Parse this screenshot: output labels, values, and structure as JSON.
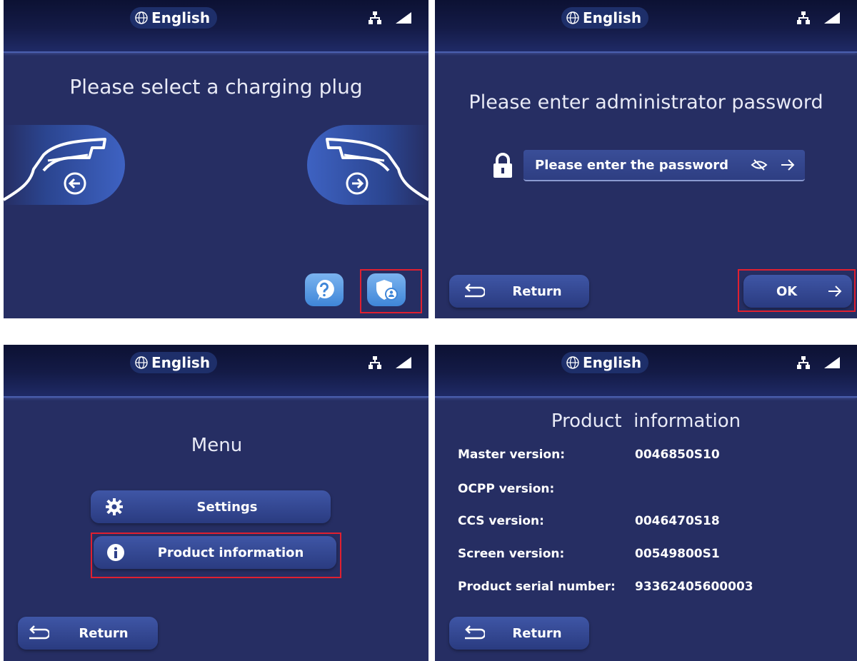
{
  "language_label": "English",
  "screen1": {
    "title": "Please select a charging plug"
  },
  "screen2": {
    "title": "Please enter administrator password",
    "password_placeholder": "Please enter the password",
    "return_label": "Return",
    "ok_label": "OK"
  },
  "screen3": {
    "title": "Menu",
    "items": [
      {
        "label": "Settings",
        "icon": "gear-icon"
      },
      {
        "label": "Product information",
        "icon": "info-icon"
      }
    ],
    "return_label": "Return"
  },
  "screen4": {
    "title": "Product  information",
    "rows": [
      {
        "label": "Master version:",
        "value": "0046850S10"
      },
      {
        "label": "OCPP version:",
        "value": ""
      },
      {
        "label": "CCS version:",
        "value": "0046470S18"
      },
      {
        "label": "Screen version:",
        "value": "00549800S1"
      },
      {
        "label": "Product serial number:",
        "value": "93362405600003"
      }
    ],
    "return_label": "Return"
  },
  "colors": {
    "background": "#262e63",
    "header": "#141b47",
    "button": "#2f418a",
    "highlight": "#e02030",
    "accent_blue": "#4a8fe0"
  }
}
